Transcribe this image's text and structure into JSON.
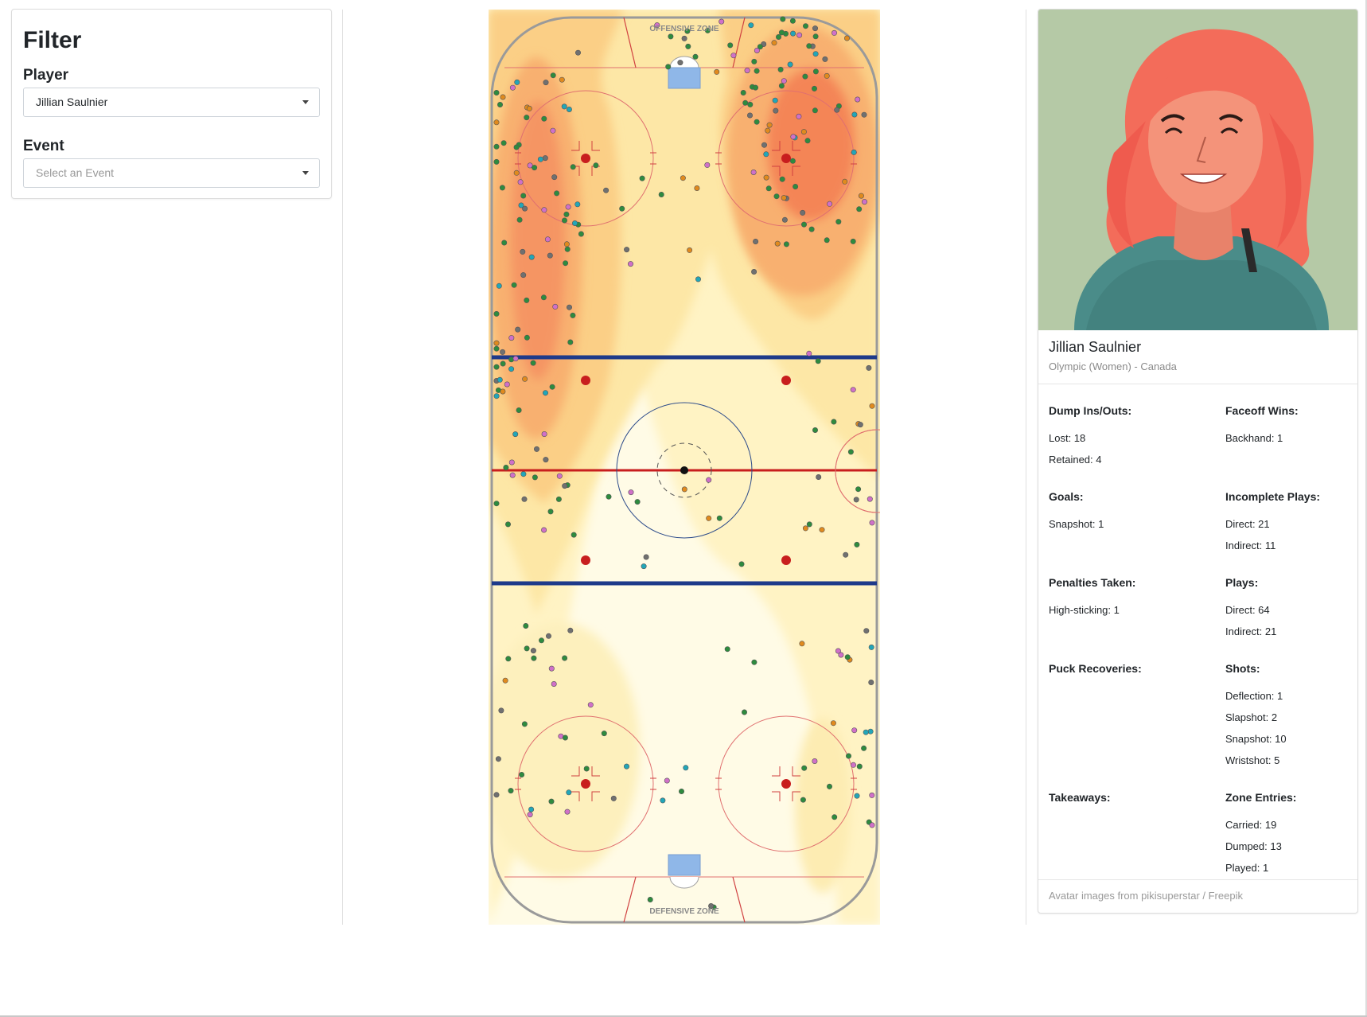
{
  "filter": {
    "title": "Filter",
    "player_label": "Player",
    "player_value": "Jillian Saulnier",
    "event_label": "Event",
    "event_placeholder": "Select an Event"
  },
  "rink": {
    "top_zone_label": "OFFENSIVE ZONE",
    "bottom_zone_label": "DEFENSIVE ZONE"
  },
  "profile": {
    "name": "Jillian Saulnier",
    "team": "Olympic (Women) - Canada",
    "stats": {
      "dump": {
        "title": "Dump Ins/Outs:",
        "lines": [
          "Lost: 18",
          "Retained: 4"
        ]
      },
      "faceoff": {
        "title": "Faceoff Wins:",
        "lines": [
          "Backhand: 1"
        ]
      },
      "goals": {
        "title": "Goals:",
        "lines": [
          "Snapshot: 1"
        ]
      },
      "incomplete": {
        "title": "Incomplete Plays:",
        "lines": [
          "Direct: 21",
          "Indirect: 11"
        ]
      },
      "penalties": {
        "title": "Penalties Taken:",
        "lines": [
          "High-sticking: 1"
        ]
      },
      "plays": {
        "title": "Plays:",
        "lines": [
          "Direct: 64",
          "Indirect: 21"
        ]
      },
      "recoveries": {
        "title": "Puck Recoveries:",
        "lines": []
      },
      "shots": {
        "title": "Shots:",
        "lines": [
          "Deflection: 1",
          "Slapshot: 2",
          "Snapshot: 10",
          "Wristshot: 5"
        ]
      },
      "takeaways": {
        "title": "Takeaways:",
        "lines": []
      },
      "zone": {
        "title": "Zone Entries:",
        "lines": [
          "Carried: 19",
          "Dumped: 13",
          "Played: 1"
        ]
      }
    },
    "footer": "Avatar images from pikisuperstar / Freepik"
  },
  "colors": {
    "heat_low": "#fff8d6",
    "heat_mid": "#fbd38d",
    "heat_high": "#f47c4a",
    "blue_line": "#1e3a8a",
    "red_line": "#c81e1e",
    "dot_green": "#2e8b3e",
    "dot_orange": "#e08a1e",
    "dot_gray": "#707070",
    "dot_cyan": "#22a6b8",
    "dot_pink": "#d070c8",
    "avatar_bg": "#b5c9a6",
    "hair": "#f36c5a",
    "skin": "#f4937a",
    "shirt": "#4a8c89"
  }
}
